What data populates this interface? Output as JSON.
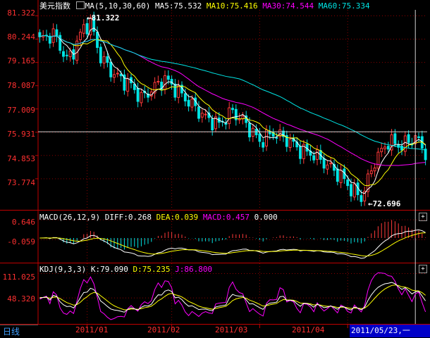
{
  "title": "美元指数",
  "tab_label": "日线",
  "cursor_date": "2011/05/23,一",
  "colors": {
    "up": "#ff3a3a",
    "down": "#00e4e4",
    "ma5": "#ffffff",
    "ma10": "#ffff00",
    "ma30": "#ff00ff",
    "ma60": "#00e4e4"
  },
  "main_legend": {
    "prefix": "MA(5,10,30,60)",
    "ma5": "MA5:75.532",
    "ma10": "MA10:75.416",
    "ma30": "MA30:74.544",
    "ma60": "MA60:75.334"
  },
  "macd_legend": {
    "prefix": "MACD(26,12,9)",
    "diff": "DIFF:0.268",
    "dea": "DEA:0.039",
    "macd": "MACD:0.457",
    "zero": "0.000"
  },
  "kdj_legend": {
    "prefix": "KDJ(9,3,3)",
    "k": "K:79.090",
    "d": "D:75.235",
    "j": "J:86.800"
  },
  "annotations": {
    "high": "81.322",
    "low": "72.696"
  },
  "chart_data": [
    {
      "type": "candlestick",
      "title": "美元指数",
      "y_ticks": [
        "81.322",
        "80.244",
        "79.165",
        "78.087",
        "77.009",
        "75.931",
        "74.853",
        "73.774"
      ],
      "ylim": [
        72.4,
        81.6
      ],
      "x_ticks": [
        "2011/01",
        "2011/02",
        "2011/03",
        "2011/04"
      ],
      "reference_line": 75.95,
      "close_anchors": [
        [
          0,
          80.2
        ],
        [
          4,
          80.5
        ],
        [
          8,
          79.3
        ],
        [
          10,
          79.7
        ],
        [
          13,
          80.8
        ],
        [
          15,
          81.0
        ],
        [
          18,
          79.4
        ],
        [
          22,
          78.6
        ],
        [
          27,
          78.1
        ],
        [
          30,
          77.5
        ],
        [
          33,
          77.9
        ],
        [
          37,
          78.4
        ],
        [
          41,
          77.8
        ],
        [
          45,
          77.2
        ],
        [
          49,
          76.6
        ],
        [
          53,
          76.3
        ],
        [
          57,
          76.9
        ],
        [
          61,
          76.3
        ],
        [
          65,
          75.5
        ],
        [
          69,
          75.9
        ],
        [
          73,
          75.6
        ],
        [
          77,
          75.1
        ],
        [
          81,
          74.9
        ],
        [
          85,
          74.4
        ],
        [
          89,
          73.9
        ],
        [
          92,
          73.3
        ],
        [
          95,
          72.9
        ],
        [
          97,
          73.7
        ],
        [
          99,
          74.6
        ],
        [
          103,
          75.5
        ],
        [
          107,
          75.3
        ],
        [
          111,
          75.7
        ],
        [
          114,
          75.0
        ]
      ],
      "series": [
        {
          "name": "MA5",
          "values": []
        },
        {
          "name": "MA10",
          "values": []
        },
        {
          "name": "MA30",
          "values": []
        },
        {
          "name": "MA60",
          "values": []
        }
      ]
    },
    {
      "type": "bar",
      "title": "MACD(26,12,9)",
      "y_ticks": [
        "0.646",
        "-0.059"
      ],
      "ylim": [
        -0.85,
        0.85
      ]
    },
    {
      "type": "line",
      "title": "KDJ(9,3,3)",
      "y_ticks": [
        "111.025",
        "48.320"
      ],
      "ylim": [
        -15,
        130
      ]
    }
  ]
}
